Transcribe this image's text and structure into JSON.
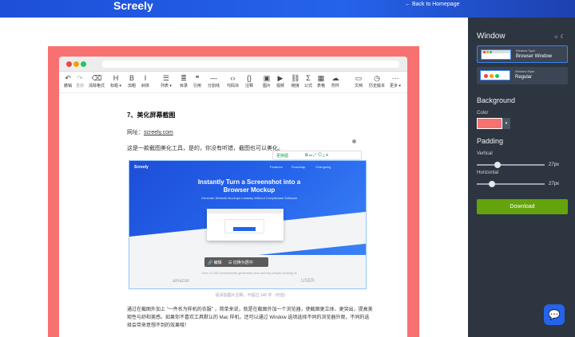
{
  "header": {
    "brand": "Screely",
    "back_link": "← Back to Homepage"
  },
  "toolbar": [
    {
      "label": "撤销",
      "icon": "↶",
      "dim": false
    },
    {
      "label": "重做",
      "icon": "↷",
      "dim": true
    },
    {
      "label": "清除格式",
      "icon": "⌫",
      "dim": false
    },
    {
      "label": "标题 ▾",
      "icon": "H",
      "dim": false
    },
    {
      "label": "加粗",
      "icon": "B",
      "dim": false
    },
    {
      "label": "斜体",
      "icon": "I",
      "dim": false
    },
    {
      "label": "列表 ▾",
      "icon": "☰",
      "dim": false
    },
    {
      "label": "目录",
      "icon": "≣",
      "dim": false
    },
    {
      "label": "引用",
      "icon": "❝",
      "dim": false
    },
    {
      "label": "分割线",
      "icon": "—",
      "dim": false
    },
    {
      "label": "代码块",
      "icon": "‹›",
      "dim": false
    },
    {
      "label": "注释",
      "icon": "{}",
      "dim": false
    },
    {
      "label": "图片",
      "icon": "▣",
      "dim": false
    },
    {
      "label": "视频",
      "icon": "▶",
      "dim": false
    },
    {
      "label": "链接",
      "icon": "⛓",
      "dim": false
    },
    {
      "label": "公式",
      "icon": "Σ",
      "dim": false
    },
    {
      "label": "表格",
      "icon": "▦",
      "dim": false
    },
    {
      "label": "附件",
      "icon": "☁",
      "dim": false
    },
    {
      "label": "文档",
      "icon": "▭",
      "dim": false
    },
    {
      "label": "历史版本",
      "icon": "◷",
      "dim": false
    },
    {
      "label": "更多 ▾",
      "icon": "⋯",
      "dim": false
    }
  ],
  "doc": {
    "heading": "7、美化屏幕截图",
    "url_label": "网址：",
    "url": "screely.com",
    "intro": "这是一款截图美化工具，是的，你没有听错，截图也可以美化。",
    "image_toolbar": {
      "replace": "更换图",
      "icons": "⧉ ▭ ⤢ ⟲ ⤓ ⊗"
    },
    "hero": {
      "brand": "Screely",
      "nav": [
        "Features",
        "Roadmap",
        "Changelog"
      ],
      "title": "Instantly Turn a Screenshot into a Browser Mockup",
      "subtitle": "Generate Website Mockups Instantly Without Complicated Software",
      "note": "No credit card or sign up is required to get started",
      "trusted": "Over 10,000 screenshots generated and used by people working at",
      "logo_left": "amazon",
      "logo_right": "USER"
    },
    "image_overlay": {
      "edit": "🔗 编辑",
      "switch": "☰ 切换为居中"
    },
    "caption": "请添加图片注释，不超过 140 字（可选）",
    "body": "通过在截图外加上 \"一件名为样机的衣服\" ，简单来说，就是在截图外加一个浏览器，使截图更立体、更突出，提高美观性与舒和美感。如果你不喜欢工具默认的 Mac 样机，还可以通过 Window 选项选择不同的浏览器外观，不同的选择会带来意想不到的效果哦！"
  },
  "panel": {
    "title": "Window",
    "mode_icons": "☼ ☾",
    "window_options": [
      {
        "caption": "Window Type",
        "value": "Browser Window",
        "selected": true
      },
      {
        "caption": "Window Style",
        "value": "Regular",
        "selected": false
      }
    ],
    "background_title": "Background",
    "color_label": "Color",
    "color_value": "#f87171",
    "padding_title": "Padding",
    "vertical_label": "Vertical",
    "vertical_value": "27px",
    "horizontal_label": "Horizontal",
    "horizontal_value": "27px",
    "download_label": "Download",
    "chat_icon": "💬"
  }
}
